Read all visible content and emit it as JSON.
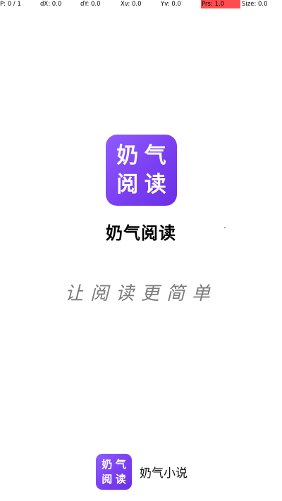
{
  "debug_bar": {
    "pointer": "P: 0 / 1",
    "dx": "dX: 0.0",
    "dy": "dY: 0.0",
    "xv": "Xv: 0.0",
    "yv": "Yv: 0.0",
    "prs": "Prs: 1.0",
    "size": "Size: 0.0",
    "prs_highlight_color": "#ff4d4d"
  },
  "app_icon": {
    "glyph_1": "奶",
    "glyph_2": "气",
    "glyph_3": "阅",
    "glyph_4": "读",
    "background_color": "#7b3ff2"
  },
  "app_name": "奶气阅读",
  "slogan": "让阅读更简单",
  "footer": {
    "icon_glyph_1": "奶",
    "icon_glyph_2": "气",
    "icon_glyph_3": "阅",
    "icon_glyph_4": "读",
    "label": "奶气小说"
  }
}
